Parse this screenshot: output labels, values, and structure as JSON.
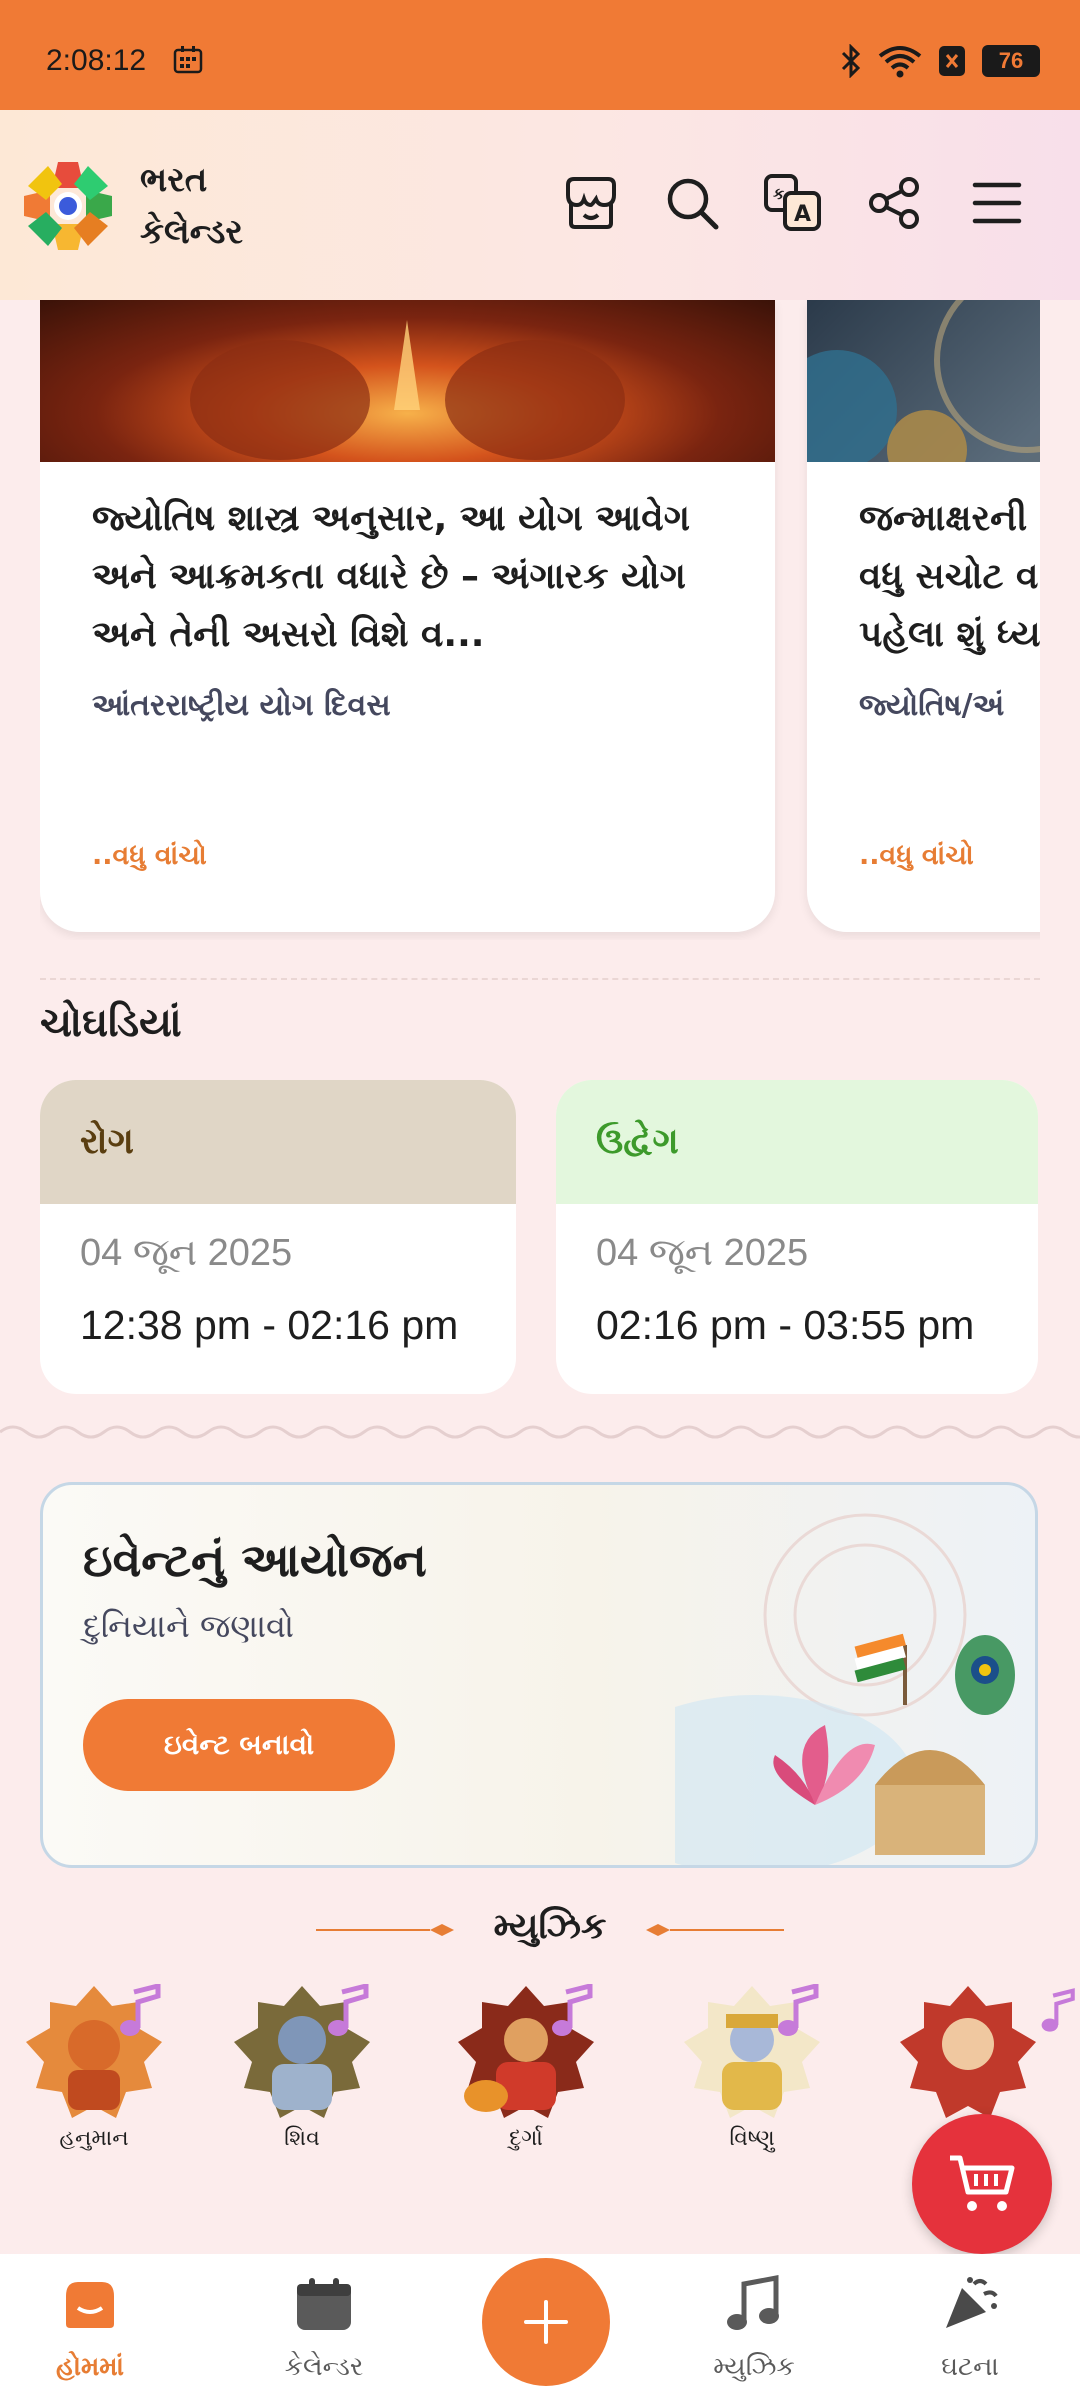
{
  "status_bar": {
    "time": "2:08:12",
    "battery": "76"
  },
  "header": {
    "brand_line1": "ભરત",
    "brand_line2": "કેલેન્ડર",
    "icons": [
      "store-icon",
      "search-icon",
      "translate-icon",
      "share-icon",
      "menu-icon"
    ]
  },
  "articles": [
    {
      "title": "જ્યોતિષ શાસ્ત્ર અનુસાર, આ યોગ આવેગ અને આક્રમકતા વધારે છે – અંગારક યોગ અને તેની અસરો વિશે વ...",
      "category": "આંતરરાષ્ટ્રીય યોગ દિવસ",
      "read_more": "..વધુ વાંચો"
    },
    {
      "title": "જન્માક્ષરની વધુ સચોટ વ પહેલા શું ધ્ય",
      "category": "જ્યોતિષ/અં",
      "read_more": "..વધુ વાંચો"
    }
  ],
  "choghadiya": {
    "title": "ચોઘડિયાં",
    "items": [
      {
        "name": "રોગ",
        "date": "04 જૂન 2025",
        "time": "12:38 pm - 02:16 pm",
        "head_bg": "#e0d6c6",
        "head_color": "#5a3e10"
      },
      {
        "name": "ઉદ્વેગ",
        "date": "04 જૂન 2025",
        "time": "02:16 pm - 03:55 pm",
        "head_bg": "#e3f7dd",
        "head_color": "#3d9a2b"
      }
    ]
  },
  "event": {
    "title": "ઇવેન્ટનું આયોજન",
    "subtitle": "દુનિયાને જણાવો",
    "button": "ઇવેન્ટ બનાવો"
  },
  "music": {
    "title": "મ્યુઝિક",
    "items": [
      {
        "name": "હનુમાન",
        "color": "#e58a3c"
      },
      {
        "name": "શિવ",
        "color": "#6b7a9a"
      },
      {
        "name": "દુર્ગા",
        "color": "#c0392b"
      },
      {
        "name": "વિષ્ણુ",
        "color": "#d6a84a"
      },
      {
        "name": "",
        "color": "#e0553a"
      }
    ]
  },
  "bottom_nav": {
    "home": "હોમમાં",
    "calendar": "કેલેન્ડર",
    "music": "મ્યુઝિક",
    "events": "ઘટના"
  },
  "colors": {
    "accent": "#f07a35",
    "cart": "#e5323c"
  }
}
